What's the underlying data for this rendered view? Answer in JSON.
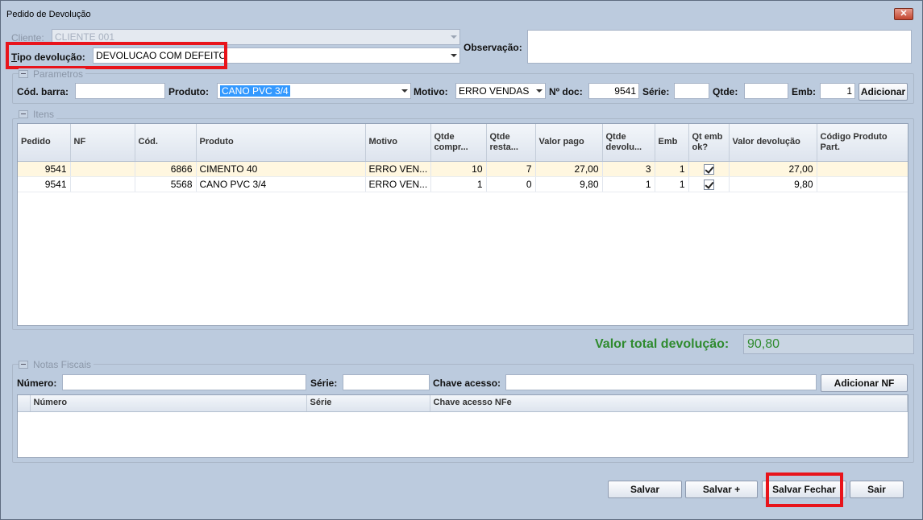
{
  "window": {
    "title": "Pedido de Devolução",
    "close_label": "✕"
  },
  "header": {
    "cliente_label": "Cliente:",
    "cliente_value": "CLIENTE 001",
    "tipo_label": "Tipo devolução:",
    "tipo_value": "DEVOLUCAO COM DEFEITO",
    "observacao_label": "Observação:",
    "observacao_value": ""
  },
  "parametros": {
    "title": "Parametros",
    "cod_barra_label": "Cód. barra:",
    "cod_barra_value": "",
    "produto_label": "Produto:",
    "produto_value": "CANO PVC 3/4",
    "motivo_label": "Motivo:",
    "motivo_value": "ERRO VENDAS",
    "ndoc_label": "Nº doc:",
    "ndoc_value": "9541",
    "serie_label": "Série:",
    "serie_value": "",
    "qtde_label": "Qtde:",
    "qtde_value": "",
    "emb_label": "Emb:",
    "emb_value": "1",
    "adicionar_label": "Adicionar"
  },
  "itens": {
    "title": "Itens",
    "columns": [
      "Pedido",
      "NF",
      "Cód.",
      "Produto",
      "Motivo",
      "Qtde compr...",
      "Qtde resta...",
      "Valor pago",
      "Qtde devolu...",
      "Emb",
      "Qt emb ok?",
      "Valor devolução",
      "Código Produto Part."
    ],
    "rows": [
      {
        "pedido": "9541",
        "nf": "",
        "cod": "6866",
        "produto": "CIMENTO 40",
        "motivo": "ERRO VEN...",
        "qtde_compr": "10",
        "qtde_resta": "7",
        "valor_pago": "27,00",
        "qtde_devolu": "3",
        "emb": "1",
        "qt_emb_ok": true,
        "valor_devolucao": "27,00",
        "codigo_part": ""
      },
      {
        "pedido": "9541",
        "nf": "",
        "cod": "5568",
        "produto": "CANO PVC 3/4",
        "motivo": "ERRO VEN...",
        "qtde_compr": "1",
        "qtde_resta": "0",
        "valor_pago": "9,80",
        "qtde_devolu": "1",
        "emb": "1",
        "qt_emb_ok": true,
        "valor_devolucao": "9,80",
        "codigo_part": ""
      }
    ]
  },
  "total": {
    "label": "Valor total devolução:",
    "value": "90,80"
  },
  "notas": {
    "title": "Notas Fiscais",
    "numero_label": "Número:",
    "numero_value": "",
    "serie_label": "Série:",
    "serie_value": "",
    "chave_label": "Chave acesso:",
    "chave_value": "",
    "adicionar_label": "Adicionar NF",
    "columns": [
      "Número",
      "Série",
      "Chave acesso NFe"
    ]
  },
  "footer": {
    "salvar": "Salvar",
    "salvar_mais": "Salvar +",
    "salvar_fechar": "Salvar Fechar",
    "sair": "Sair"
  },
  "colors": {
    "highlight_box": "#e8141b",
    "total_text": "#2f8b2f",
    "window_bg": "#bccbde"
  }
}
